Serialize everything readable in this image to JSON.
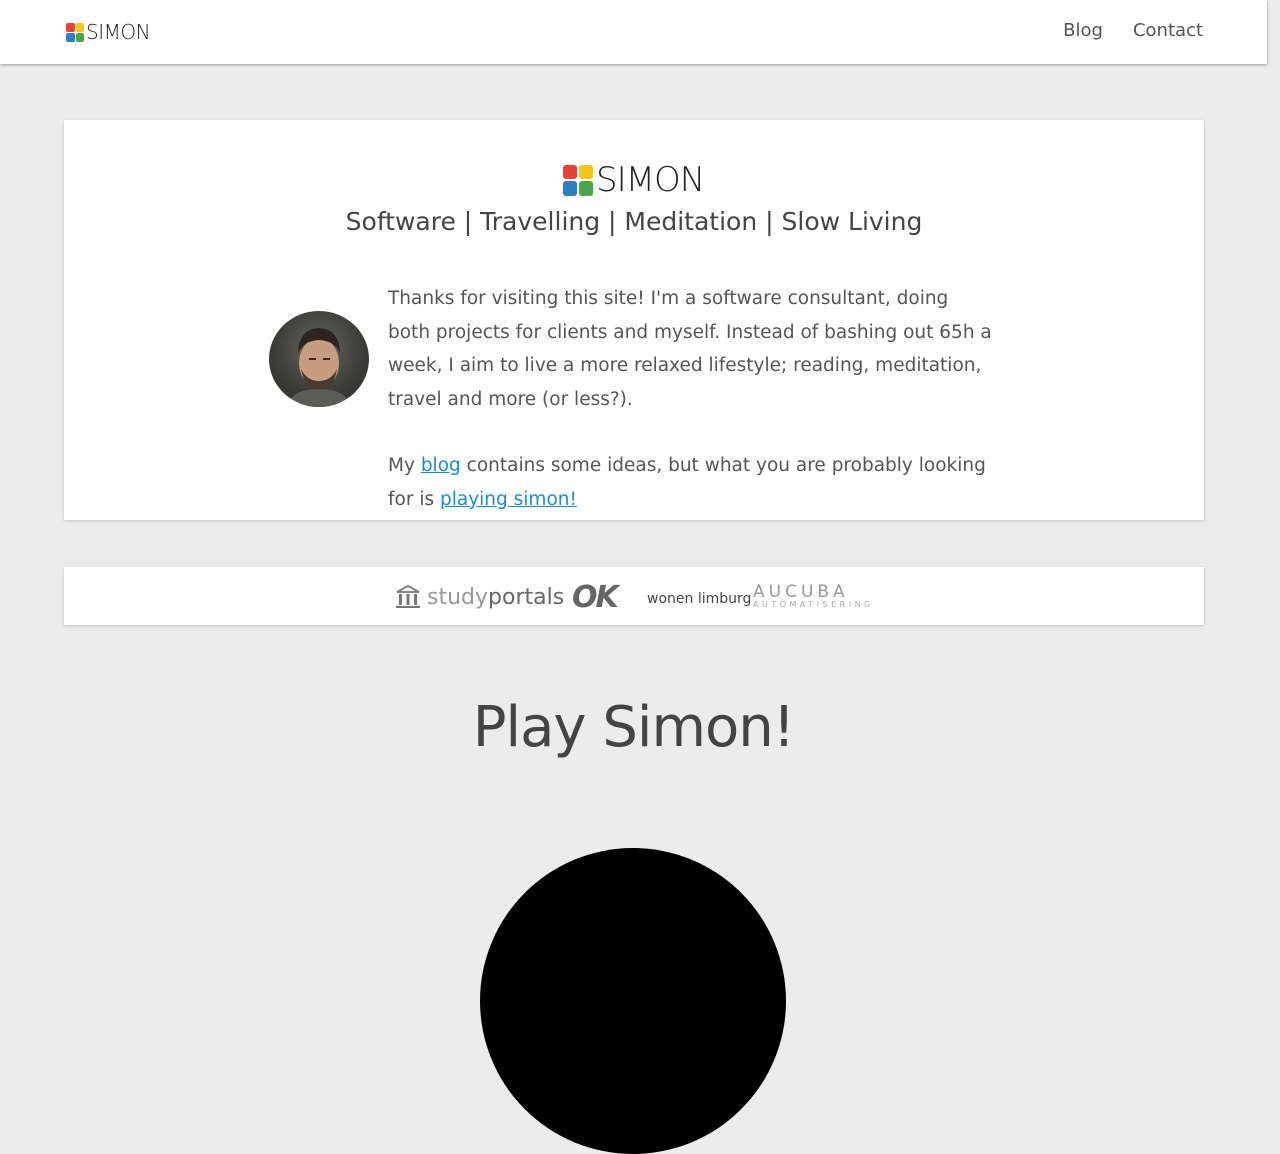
{
  "brand": {
    "name": "SIMON",
    "colors": [
      "#e8413c",
      "#f5c518",
      "#2d7fc0",
      "#4aa64a"
    ]
  },
  "nav": {
    "links": [
      "Blog",
      "Contact"
    ]
  },
  "hero": {
    "tagline": "Software | Travelling | Meditation | Slow Living",
    "avatar_icon": "portrait-photo",
    "intro_paragraph": "Thanks for visiting this site! I'm a software consultant, doing both projects for clients and myself. Instead of bashing out 65h a week, I aim to live a more relaxed lifestyle; reading, meditation, travel and more (or less?).",
    "blog_sentence_prefix": "My",
    "blog_link": "blog",
    "blog_sentence_middle": "contains some ideas, but what you are probably looking for is",
    "play_link": "playing simon!"
  },
  "clients": {
    "studyportals_study": "study",
    "studyportals_portals": "portals",
    "ok": "OK",
    "wonen_limburg": "wonen limburg",
    "aucuba": "AUCUBA",
    "aucuba_sub": "AUTOMATISERING"
  },
  "game": {
    "title": "Play Simon!"
  }
}
